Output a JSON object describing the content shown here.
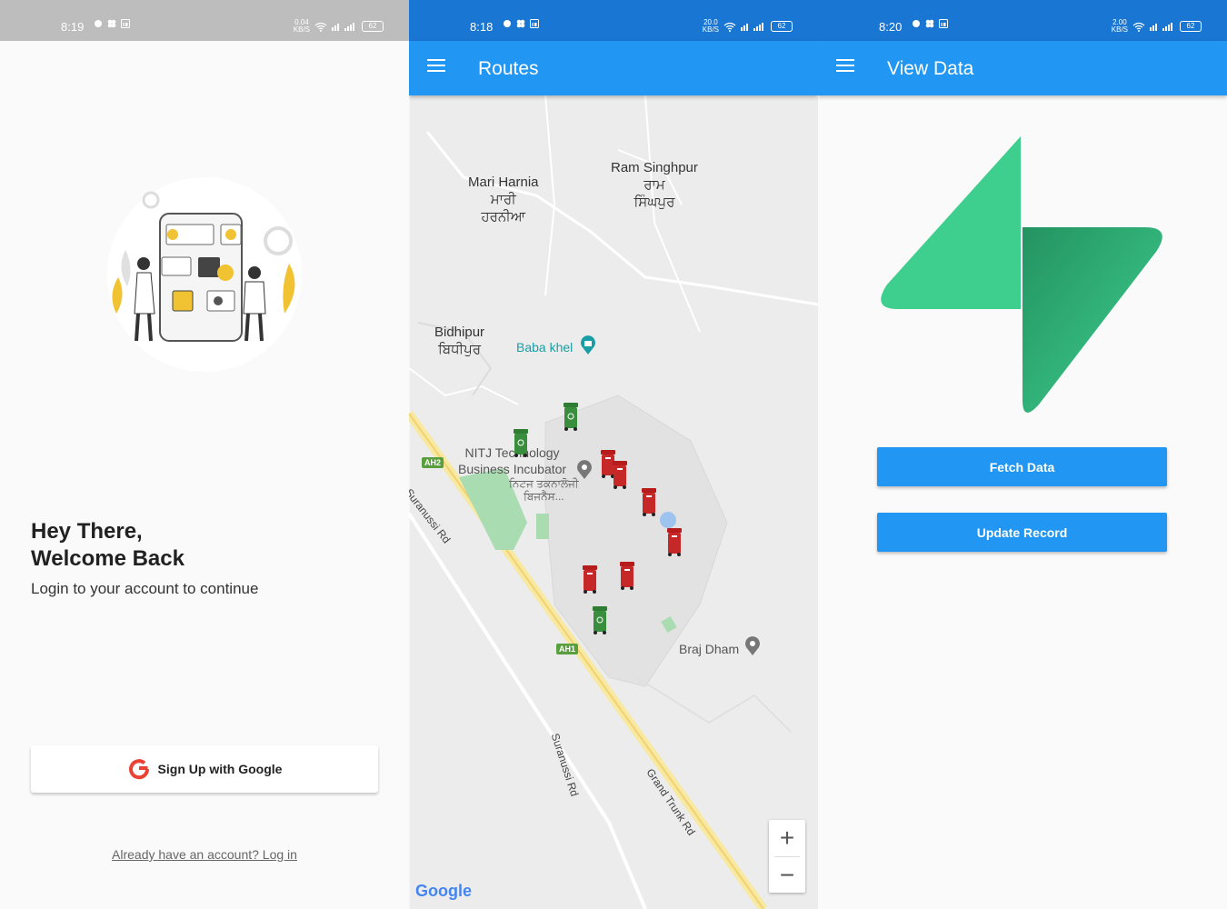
{
  "screens": [
    {
      "status": {
        "time": "8:19",
        "speed": "0.04\nKB/S",
        "battery": "62"
      },
      "greeting_line1": "Hey There,",
      "greeting_line2": "Welcome Back",
      "subtitle": "Login to your account to continue",
      "google_button_label": "Sign Up with Google",
      "login_link": "Already have an account? Log in"
    },
    {
      "status": {
        "time": "8:18",
        "speed": "20.0\nKB/S",
        "battery": "62"
      },
      "title": "Routes",
      "map": {
        "places": [
          {
            "name": "Mari Harnia",
            "local": "ਮਾਰੀ\nਹਰਨੀਆ"
          },
          {
            "name": "Ram Singhpur",
            "local": "ਰਾਮ\nਸਿੰਘਪੁਰ"
          },
          {
            "name": "Bidhipur",
            "local": "ਬਿਧੀਪੁਰ"
          }
        ],
        "pois": [
          "Baba khel",
          "NITJ Technology\nBusiness Incubator",
          "ਨਿਟਜ ਤਕਨਾਲੋਜੀ\nਬਿਜਨੈਸ...",
          "Braj Dham"
        ],
        "roads": [
          "Suranussi Rd",
          "Suranussi Rd",
          "Grand Trunk Rd"
        ],
        "highways": [
          "AH2",
          "AH1"
        ],
        "zoom_in": "+",
        "zoom_out": "−",
        "attribution": "Google"
      }
    },
    {
      "status": {
        "time": "8:20",
        "speed": "2.00\nKB/S",
        "battery": "62"
      },
      "title": "View Data",
      "fetch_label": "Fetch Data",
      "update_label": "Update Record"
    }
  ],
  "colors": {
    "appbar": "#2196f3",
    "status_blue": "#1976d2",
    "status_grey": "#bdbdbd",
    "bin_red": "#c62828",
    "bin_green": "#2e7d32",
    "logo_green": "#3ecf8e"
  }
}
